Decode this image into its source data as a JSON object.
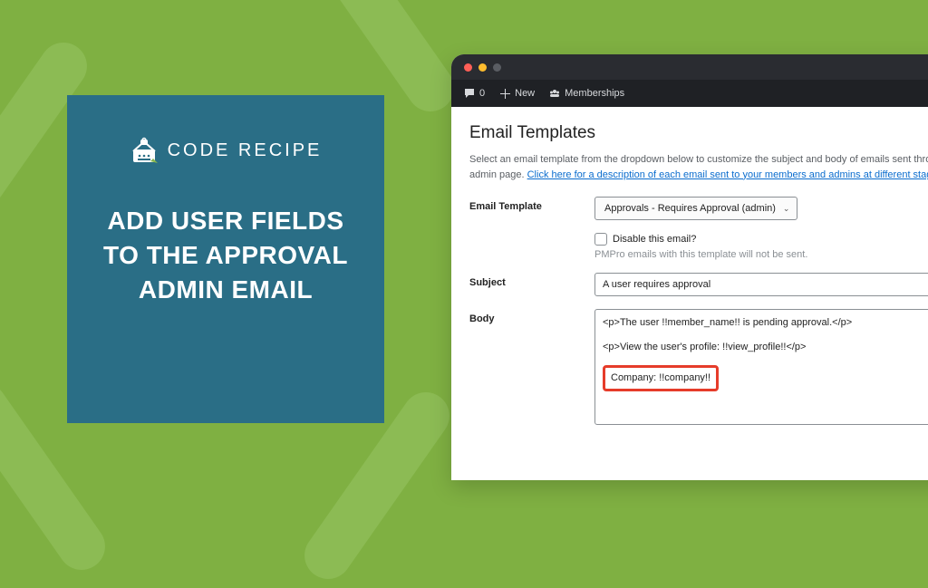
{
  "hero": {
    "brand": "CODE RECIPE",
    "title": "ADD USER FIELDS TO THE APPROVAL ADMIN EMAIL"
  },
  "adminbar": {
    "comments_count": "0",
    "new_label": "New",
    "memberships_label": "Memberships"
  },
  "page": {
    "title": "Email Templates",
    "intro_pre": "Select an email template from the dropdown below to customize the subject and body of emails sent through your memb",
    "intro_post": "admin page. ",
    "intro_link": "Click here for a description of each email sent to your members and admins at different stages of the memb"
  },
  "form": {
    "template_label": "Email Template",
    "template_value": "Approvals - Requires Approval (admin)",
    "disable_label": "Disable this email?",
    "disable_helper": "PMPro emails with this template will not be sent.",
    "subject_label": "Subject",
    "subject_value": "A user requires approval",
    "body_label": "Body",
    "body_line1": "<p>The user !!member_name!! is pending approval.</p>",
    "body_line2": "<p>View the user's profile: !!view_profile!!</p>",
    "body_highlight": "Company: !!company!!"
  }
}
